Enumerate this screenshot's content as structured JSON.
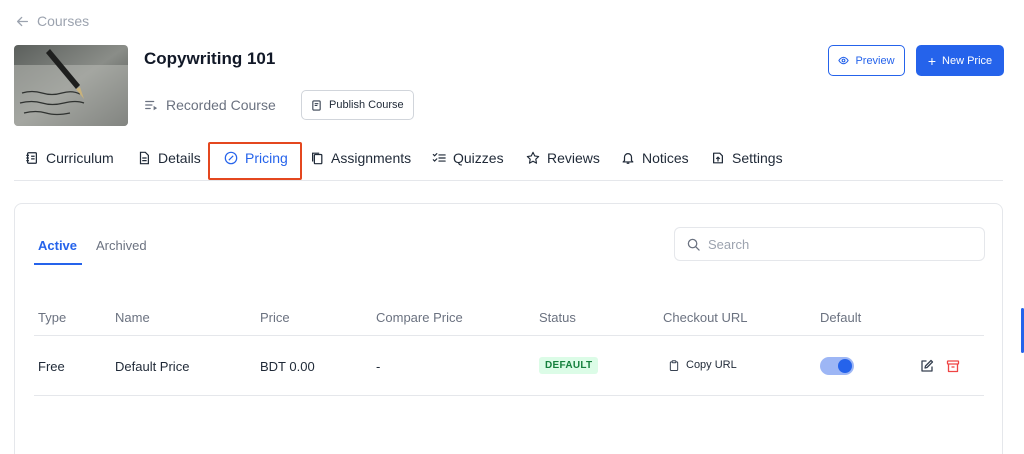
{
  "breadcrumb": {
    "label": "Courses"
  },
  "course": {
    "title": "Copywriting 101",
    "type_label": "Recorded Course",
    "publish_label": "Publish Course"
  },
  "header_actions": {
    "preview_label": "Preview",
    "new_price_label": "New Price"
  },
  "tabs": [
    {
      "label": "Curriculum",
      "icon": "curriculum-icon",
      "active": false
    },
    {
      "label": "Details",
      "icon": "document-icon",
      "active": false
    },
    {
      "label": "Pricing",
      "icon": "pricing-icon",
      "active": true
    },
    {
      "label": "Assignments",
      "icon": "copy-icon",
      "active": false
    },
    {
      "label": "Quizzes",
      "icon": "checklist-icon",
      "active": false
    },
    {
      "label": "Reviews",
      "icon": "star-icon",
      "active": false
    },
    {
      "label": "Notices",
      "icon": "bell-icon",
      "active": false
    },
    {
      "label": "Settings",
      "icon": "settings-icon",
      "active": false
    }
  ],
  "pricing": {
    "subtabs": [
      {
        "label": "Active",
        "active": true
      },
      {
        "label": "Archived",
        "active": false
      }
    ],
    "search_placeholder": "Search",
    "columns": [
      "Type",
      "Name",
      "Price",
      "Compare Price",
      "Status",
      "Checkout URL",
      "Default"
    ],
    "rows": [
      {
        "type": "Free",
        "name": "Default Price",
        "price": "BDT 0.00",
        "compare_price": "-",
        "status": "DEFAULT",
        "checkout_label": "Copy URL",
        "default_on": true
      }
    ]
  },
  "colors": {
    "accent": "#2563eb",
    "highlight_box": "#e4471f",
    "badge_bg": "#dcfce7",
    "badge_text": "#15803d",
    "delete": "#ef4444"
  }
}
